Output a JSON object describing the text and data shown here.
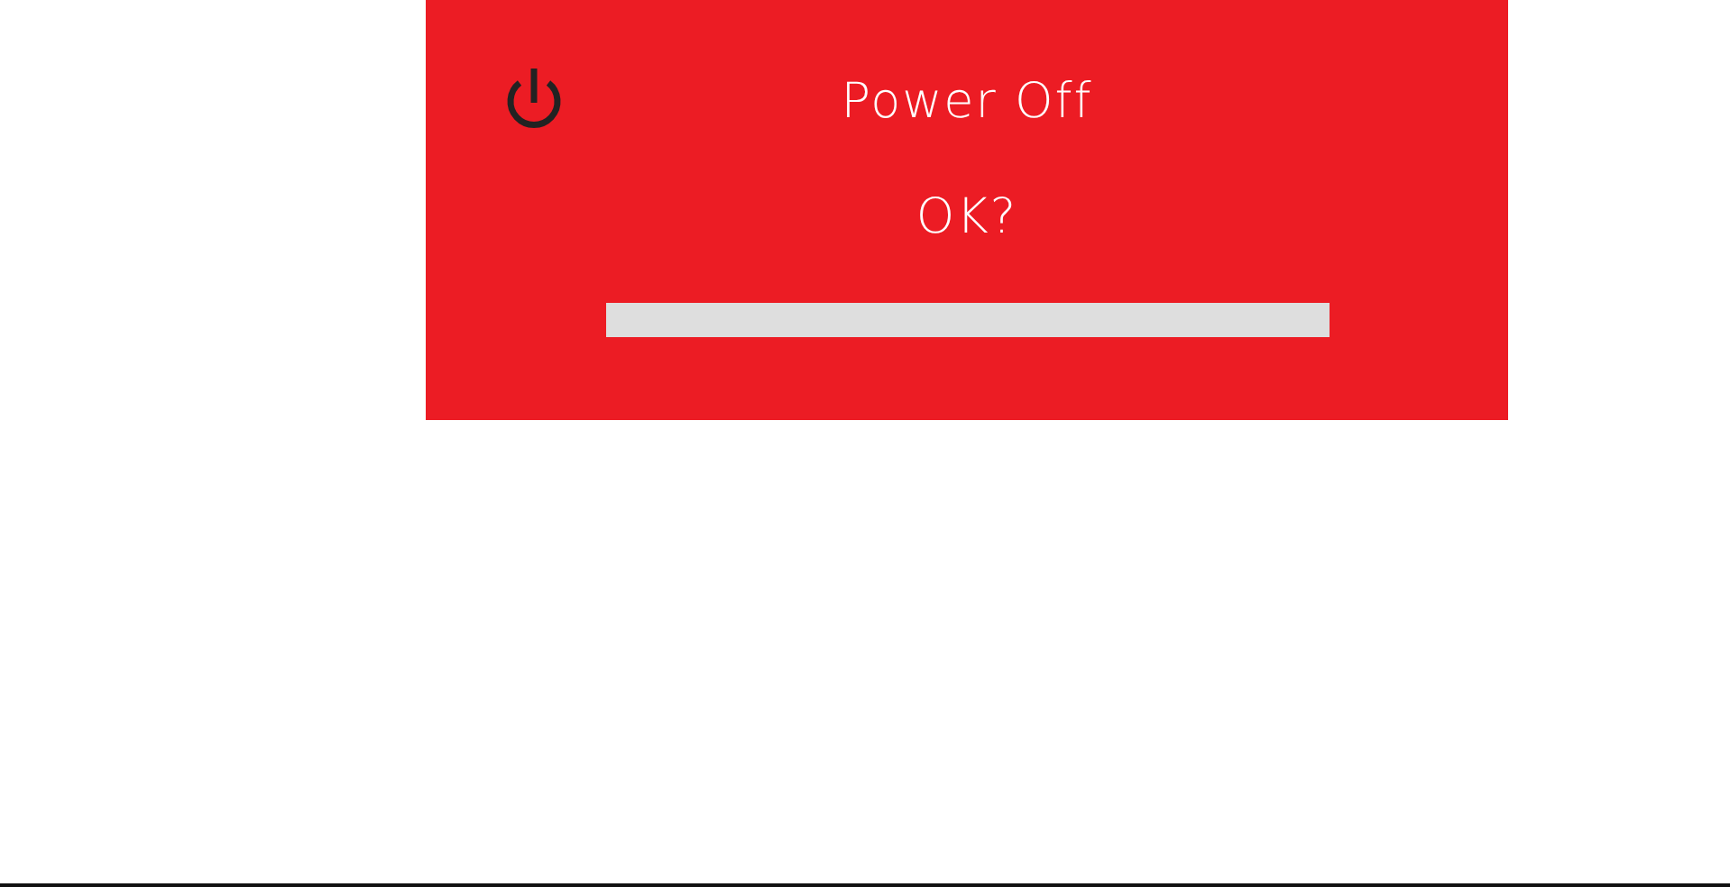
{
  "dialog": {
    "title": "Power Off",
    "prompt": "OK?"
  }
}
